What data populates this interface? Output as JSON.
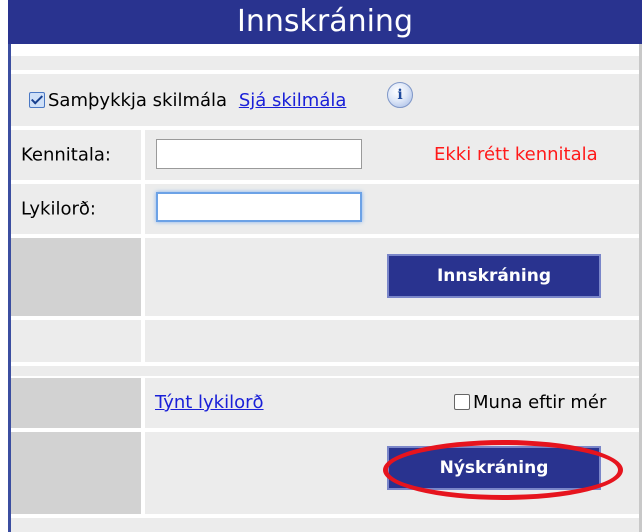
{
  "header": {
    "title": "Innskráning"
  },
  "terms": {
    "checkbox_label": "Samþykkja skilmála",
    "checked": true,
    "link": "Sjá skilmála",
    "info_icon": "info-icon"
  },
  "form": {
    "kennitala_label": "Kennitala:",
    "kennitala_value": "",
    "error": "Ekki rétt kennitala",
    "password_label": "Lykilorð:",
    "password_value": ""
  },
  "buttons": {
    "login": "Innskráning",
    "register": "Nýskráning"
  },
  "links": {
    "forgot_password": "Týnt lykilorð"
  },
  "remember": {
    "label": "Muna eftir mér",
    "checked": false
  },
  "colors": {
    "header_bg": "#29338f",
    "button_bg": "#29338f",
    "error": "#ff1a1a",
    "link": "#1a20d8",
    "highlight": "#e6141e"
  }
}
